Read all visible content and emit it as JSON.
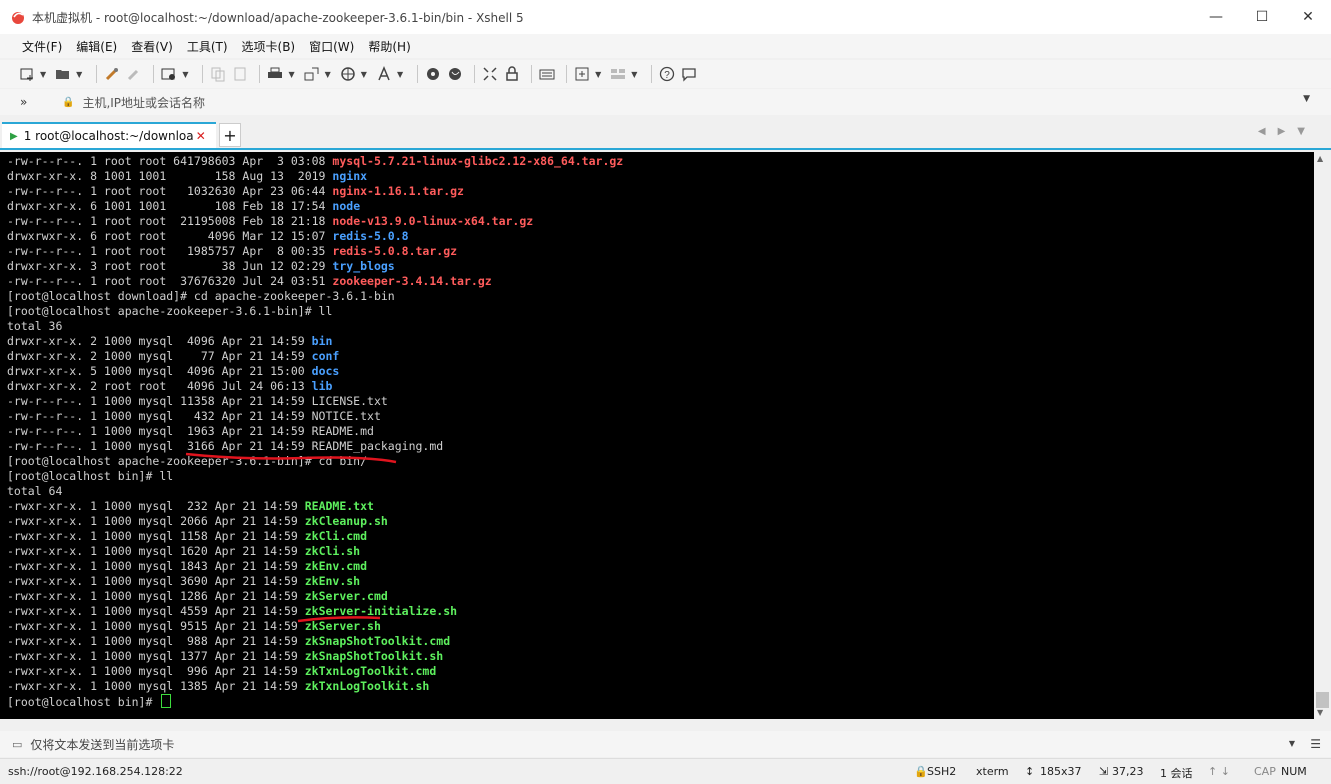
{
  "window": {
    "title": "本机虚拟机 - root@localhost:~/download/apache-zookeeper-3.6.1-bin/bin - Xshell 5",
    "minimize_glyph": "—",
    "maximize_glyph": "☐",
    "close_glyph": "✕"
  },
  "menu": [
    "文件(F)",
    "编辑(E)",
    "查看(V)",
    "工具(T)",
    "选项卡(B)",
    "窗口(W)",
    "帮助(H)"
  ],
  "toolbar_icons": [
    "new-session-icon",
    "open-folder-icon",
    "key-icon",
    "eraser-icon",
    "session-properties-icon",
    "copy-icon",
    "paste-icon",
    "print-icon",
    "transfer-icon",
    "globe-icon",
    "font-icon",
    "xftp-icon",
    "xshell-icon",
    "fullscreen-icon",
    "lock-icon",
    "keyboard-icon",
    "compose-icon",
    "layout-icon",
    "help-icon",
    "chat-icon"
  ],
  "address": {
    "chevron": "»",
    "placeholder": "主机,IP地址或会话名称"
  },
  "tab": {
    "label": "1 root@localhost:~/download...",
    "close": "✕",
    "add": "+"
  },
  "terminal": {
    "lines": [
      [
        {
          "t": "-rw-r--r--. 1 root root 641798603 Apr  3 03:08 "
        },
        {
          "t": "mysql-5.7.21-linux-glibc2.12-x86_64.tar.gz",
          "c": "red"
        }
      ],
      [
        {
          "t": "drwxr-xr-x. 8 1001 1001       158 Aug 13  2019 "
        },
        {
          "t": "nginx",
          "c": "blue"
        }
      ],
      [
        {
          "t": "-rw-r--r--. 1 root root   1032630 Apr 23 06:44 "
        },
        {
          "t": "nginx-1.16.1.tar.gz",
          "c": "red"
        }
      ],
      [
        {
          "t": "drwxr-xr-x. 6 1001 1001       108 Feb 18 17:54 "
        },
        {
          "t": "node",
          "c": "blue"
        }
      ],
      [
        {
          "t": "-rw-r--r--. 1 root root  21195008 Feb 18 21:18 "
        },
        {
          "t": "node-v13.9.0-linux-x64.tar.gz",
          "c": "red"
        }
      ],
      [
        {
          "t": "drwxrwxr-x. 6 root root      4096 Mar 12 15:07 "
        },
        {
          "t": "redis-5.0.8",
          "c": "blue"
        }
      ],
      [
        {
          "t": "-rw-r--r--. 1 root root   1985757 Apr  8 00:35 "
        },
        {
          "t": "redis-5.0.8.tar.gz",
          "c": "red"
        }
      ],
      [
        {
          "t": "drwxr-xr-x. 3 root root        38 Jun 12 02:29 "
        },
        {
          "t": "try_blogs",
          "c": "blue"
        }
      ],
      [
        {
          "t": "-rw-r--r--. 1 root root  37676320 Jul 24 03:51 "
        },
        {
          "t": "zookeeper-3.4.14.tar.gz",
          "c": "red"
        }
      ],
      [
        {
          "t": "[root@localhost download]# cd apache-zookeeper-3.6.1-bin"
        }
      ],
      [
        {
          "t": "[root@localhost apache-zookeeper-3.6.1-bin]# ll"
        }
      ],
      [
        {
          "t": "total 36"
        }
      ],
      [
        {
          "t": "drwxr-xr-x. 2 1000 mysql  4096 Apr 21 14:59 "
        },
        {
          "t": "bin",
          "c": "blue"
        }
      ],
      [
        {
          "t": "drwxr-xr-x. 2 1000 mysql    77 Apr 21 14:59 "
        },
        {
          "t": "conf",
          "c": "blue"
        }
      ],
      [
        {
          "t": "drwxr-xr-x. 5 1000 mysql  4096 Apr 21 15:00 "
        },
        {
          "t": "docs",
          "c": "blue"
        }
      ],
      [
        {
          "t": "drwxr-xr-x. 2 root root   4096 Jul 24 06:13 "
        },
        {
          "t": "lib",
          "c": "blue"
        }
      ],
      [
        {
          "t": "-rw-r--r--. 1 1000 mysql 11358 Apr 21 14:59 LICENSE.txt"
        }
      ],
      [
        {
          "t": "-rw-r--r--. 1 1000 mysql   432 Apr 21 14:59 NOTICE.txt"
        }
      ],
      [
        {
          "t": "-rw-r--r--. 1 1000 mysql  1963 Apr 21 14:59 README.md"
        }
      ],
      [
        {
          "t": "-rw-r--r--. 1 1000 mysql  3166 Apr 21 14:59 README_packaging.md"
        }
      ],
      [
        {
          "t": "[root@localhost apache-zookeeper-3.6.1-bin]# cd bin/"
        }
      ],
      [
        {
          "t": "[root@localhost bin]# ll"
        }
      ],
      [
        {
          "t": "total 64"
        }
      ],
      [
        {
          "t": "-rwxr-xr-x. 1 1000 mysql  232 Apr 21 14:59 "
        },
        {
          "t": "README.txt",
          "c": "green"
        }
      ],
      [
        {
          "t": "-rwxr-xr-x. 1 1000 mysql 2066 Apr 21 14:59 "
        },
        {
          "t": "zkCleanup.sh",
          "c": "green"
        }
      ],
      [
        {
          "t": "-rwxr-xr-x. 1 1000 mysql 1158 Apr 21 14:59 "
        },
        {
          "t": "zkCli.cmd",
          "c": "green"
        }
      ],
      [
        {
          "t": "-rwxr-xr-x. 1 1000 mysql 1620 Apr 21 14:59 "
        },
        {
          "t": "zkCli.sh",
          "c": "green"
        }
      ],
      [
        {
          "t": "-rwxr-xr-x. 1 1000 mysql 1843 Apr 21 14:59 "
        },
        {
          "t": "zkEnv.cmd",
          "c": "green"
        }
      ],
      [
        {
          "t": "-rwxr-xr-x. 1 1000 mysql 3690 Apr 21 14:59 "
        },
        {
          "t": "zkEnv.sh",
          "c": "green"
        }
      ],
      [
        {
          "t": "-rwxr-xr-x. 1 1000 mysql 1286 Apr 21 14:59 "
        },
        {
          "t": "zkServer.cmd",
          "c": "green"
        }
      ],
      [
        {
          "t": "-rwxr-xr-x. 1 1000 mysql 4559 Apr 21 14:59 "
        },
        {
          "t": "zkServer-initialize.sh",
          "c": "green"
        }
      ],
      [
        {
          "t": "-rwxr-xr-x. 1 1000 mysql 9515 Apr 21 14:59 "
        },
        {
          "t": "zkServer.sh",
          "c": "green"
        }
      ],
      [
        {
          "t": "-rwxr-xr-x. 1 1000 mysql  988 Apr 21 14:59 "
        },
        {
          "t": "zkSnapShotToolkit.cmd",
          "c": "green"
        }
      ],
      [
        {
          "t": "-rwxr-xr-x. 1 1000 mysql 1377 Apr 21 14:59 "
        },
        {
          "t": "zkSnapShotToolkit.sh",
          "c": "green"
        }
      ],
      [
        {
          "t": "-rwxr-xr-x. 1 1000 mysql  996 Apr 21 14:59 "
        },
        {
          "t": "zkTxnLogToolkit.cmd",
          "c": "green"
        }
      ],
      [
        {
          "t": "-rwxr-xr-x. 1 1000 mysql 1385 Apr 21 14:59 "
        },
        {
          "t": "zkTxnLogToolkit.sh",
          "c": "green"
        }
      ],
      [
        {
          "t": "[root@localhost bin]# "
        }
      ]
    ],
    "colors": {
      "red": "#ff5c5c",
      "blue": "#4aa0ff",
      "green": "#5ef05e",
      "annotation": "#e0141e"
    }
  },
  "sendbar": {
    "placeholder": "仅将文本发送到当前选项卡"
  },
  "status": {
    "connection": "ssh://root@192.168.254.128:22",
    "protocol": "SSH2",
    "term": "xterm",
    "size": "185x37",
    "cursor": "37,23",
    "sessions": "1 会话",
    "cap": "CAP",
    "num": "NUM"
  }
}
